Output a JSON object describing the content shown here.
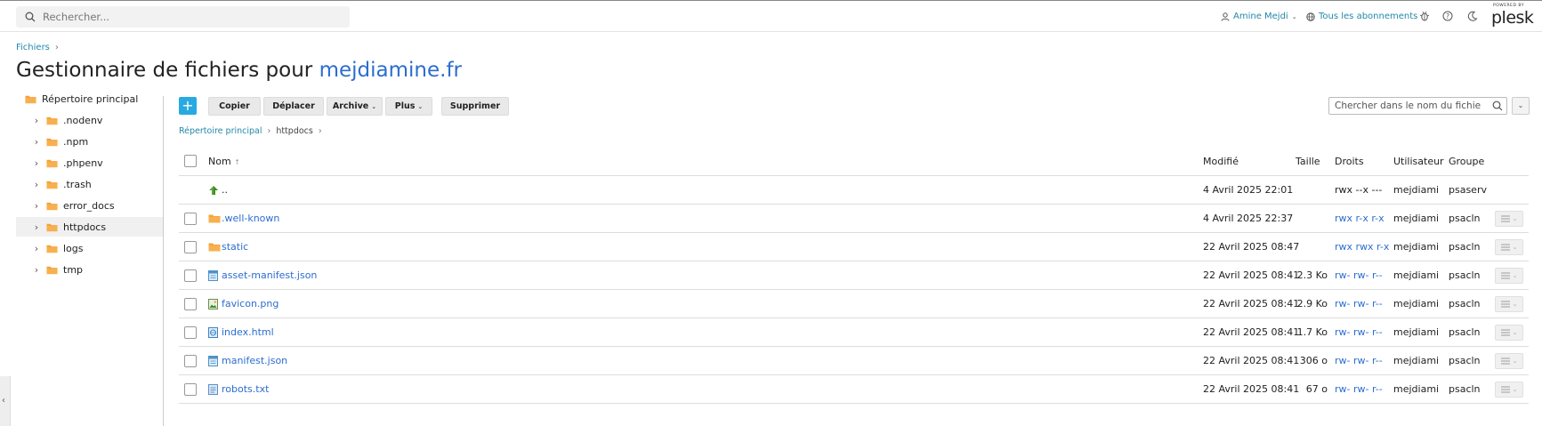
{
  "header": {
    "search_placeholder": "Rechercher...",
    "user_label": "Amine Mejdi",
    "subscriptions_label": "Tous les abonnements",
    "logo_powered": "POWERED BY",
    "logo_brand": "plesk"
  },
  "breadcrumb": {
    "root": "Fichiers"
  },
  "title": {
    "prefix": "Gestionnaire de fichiers pour",
    "domain": "mejdiamine.fr"
  },
  "tree": {
    "root": "Répertoire principal",
    "items": [
      {
        "label": ".nodenv"
      },
      {
        "label": ".npm"
      },
      {
        "label": ".phpenv"
      },
      {
        "label": ".trash"
      },
      {
        "label": "error_docs"
      },
      {
        "label": "httpdocs",
        "selected": true
      },
      {
        "label": "logs"
      },
      {
        "label": "tmp"
      }
    ]
  },
  "toolbar": {
    "add_label": "+",
    "copy_label": "Copier",
    "move_label": "Déplacer",
    "archive_label": "Archive",
    "more_label": "Plus",
    "delete_label": "Supprimer",
    "filename_search_placeholder": "Chercher dans le nom du fichie"
  },
  "path": {
    "root": "Répertoire principal",
    "current": "httpdocs"
  },
  "table": {
    "headers": {
      "name": "Nom",
      "sort_indicator": "↑",
      "modified": "Modifié",
      "size": "Taille",
      "rights": "Droits",
      "user": "Utilisateur",
      "group": "Groupe"
    },
    "rows": [
      {
        "icon": "parent-directory-icon",
        "name": "..",
        "modified": "4 Avril 2025 22:01",
        "size": "",
        "rights": "rwx --x ---",
        "user": "mejdiami",
        "group": "psaserv"
      },
      {
        "icon": "folder-icon",
        "name": ".well-known",
        "modified": "4 Avril 2025 22:37",
        "size": "",
        "rights": "rwx r-x r-x",
        "user": "mejdiami",
        "group": "psacln"
      },
      {
        "icon": "folder-icon",
        "name": "static",
        "modified": "22 Avril 2025 08:47",
        "size": "",
        "rights": "rwx rwx r-x",
        "user": "mejdiami",
        "group": "psacln"
      },
      {
        "icon": "json-file-icon",
        "name": "asset-manifest.json",
        "modified": "22 Avril 2025 08:41",
        "size": "2.3 Ko",
        "rights": "rw- rw- r--",
        "user": "mejdiami",
        "group": "psacln"
      },
      {
        "icon": "image-file-icon",
        "name": "favicon.png",
        "modified": "22 Avril 2025 08:41",
        "size": "2.9 Ko",
        "rights": "rw- rw- r--",
        "user": "mejdiami",
        "group": "psacln"
      },
      {
        "icon": "html-file-icon",
        "name": "index.html",
        "modified": "22 Avril 2025 08:41",
        "size": "1.7 Ko",
        "rights": "rw- rw- r--",
        "user": "mejdiami",
        "group": "psacln"
      },
      {
        "icon": "json-file-icon",
        "name": "manifest.json",
        "modified": "22 Avril 2025 08:41",
        "size": "306 o",
        "rights": "rw- rw- r--",
        "user": "mejdiami",
        "group": "psacln"
      },
      {
        "icon": "text-file-icon",
        "name": "robots.txt",
        "modified": "22 Avril 2025 08:41",
        "size": "67 o",
        "rights": "rw- rw- r--",
        "user": "mejdiami",
        "group": "psacln"
      }
    ]
  },
  "colors": {
    "accent": "#28aae1",
    "link": "#2c6dcf",
    "folder": "#f5a33b"
  }
}
